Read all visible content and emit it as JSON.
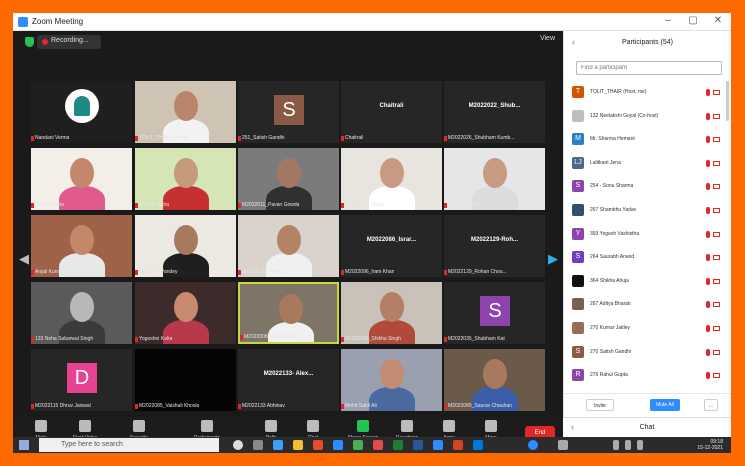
{
  "window": {
    "title": "Zoom Meeting"
  },
  "video": {
    "recording_label": "Recording...",
    "view_label": "View",
    "tiles": [
      {
        "name": "Nandani Verma",
        "kind": "logo",
        "bg": "#1f1f1f"
      },
      {
        "name": "TOLIT_THAIR (Guest)",
        "kind": "person",
        "bg": "#cfc3b3",
        "skin": "#b9856b",
        "cloth": "#f2f2f2"
      },
      {
        "name": "251_Satish Gandhi",
        "kind": "letter",
        "letter": "S",
        "color": "#8a5a44",
        "bg": "#262626"
      },
      {
        "name": "Chaitrali",
        "kind": "text",
        "caption": "Chaitrali",
        "bg": "#262626"
      },
      {
        "name": "M2022026_Shubham Kumb...",
        "kind": "text",
        "caption": "M2022022_Shub...",
        "bg": "#262626"
      },
      {
        "name": "Kajal Chawla",
        "kind": "person",
        "bg": "#f3efe8",
        "skin": "#c4876b",
        "cloth": "#e05a8c"
      },
      {
        "name": "Srishti - Saha",
        "kind": "person",
        "bg": "#d6e5b5",
        "skin": "#c79a7a",
        "cloth": "#c73030"
      },
      {
        "name": "M2022011_Pavan Gowda",
        "kind": "person",
        "bg": "#7b7b7b",
        "skin": "#a27860",
        "cloth": "#303030"
      },
      {
        "name": "M2022119_Disha",
        "kind": "person",
        "bg": "#e8e4de",
        "skin": "#c99a82",
        "cloth": "#ffffff"
      },
      {
        "name": "40_Shiv Kumari",
        "kind": "person",
        "bg": "#e6e6e6",
        "skin": "#c99a82",
        "cloth": "#dcdcdc"
      },
      {
        "name": "Anjali Kumari",
        "kind": "person",
        "bg": "#9e6248",
        "skin": "#c48869",
        "cloth": "#e8e8e8"
      },
      {
        "name": "Vaishnav Pandey",
        "kind": "person",
        "bg": "#ece8e2",
        "skin": "#a77a5e",
        "cloth": "#1f1f1f"
      },
      {
        "name": "M2022128_Kumar",
        "kind": "person",
        "bg": "#d9d3cc",
        "skin": "#b48265",
        "cloth": "#f0f0f0"
      },
      {
        "name": "M2022096_Iram Khan",
        "kind": "text",
        "caption": "M2022086_Israr...",
        "bg": "#262626"
      },
      {
        "name": "M2022129_Rohan Chou...",
        "kind": "text",
        "caption": "M2022129-Roh...",
        "bg": "#262626"
      },
      {
        "name": "133 Neha Sabarwal Singh",
        "kind": "person",
        "bg": "#5a5a5a",
        "skin": "#b8b8b8",
        "cloth": "#3a3a3a"
      },
      {
        "name": "Yogeshni Kalra",
        "kind": "person",
        "bg": "#3d2b2b",
        "skin": "#c78a70",
        "cloth": "#b83a4a"
      },
      {
        "name": "M2022008_Vikas Yadav",
        "kind": "person",
        "bg": "#7f7566",
        "skin": "#a9795e",
        "cloth": "#f0f0f0",
        "active": true
      },
      {
        "name": "M2022028_Shikha Singh",
        "kind": "person",
        "bg": "#c9c2b8",
        "skin": "#b57e66",
        "cloth": "#b04a3a"
      },
      {
        "name": "M2022035_Shubham Kat",
        "kind": "letter",
        "letter": "S",
        "color": "#8e44ad",
        "bg": "#262626"
      },
      {
        "name": "M2022115 Dhruv Jaiswal",
        "kind": "letter",
        "letter": "D",
        "color": "#e84393",
        "bg": "#262626"
      },
      {
        "name": "M2022085_Vaishali Khosla",
        "kind": "black",
        "bg": "#050505"
      },
      {
        "name": "M2022133 Abhinav",
        "kind": "text",
        "caption": "M2022133- Alex...",
        "bg": "#262626"
      },
      {
        "name": "Mohd Sahil Ali",
        "kind": "person",
        "bg": "#9aa0b0",
        "skin": "#c18c73",
        "cloth": "#4a6aa0"
      },
      {
        "name": "M2022089_Saurav Chauhan",
        "kind": "person",
        "bg": "#6b5a4a",
        "skin": "#a9795e",
        "cloth": "#3a5fa8"
      }
    ]
  },
  "toolbar": {
    "items": [
      {
        "label": "Mute"
      },
      {
        "label": "Start Video"
      },
      {
        "label": "Security"
      },
      {
        "label": "Participants"
      },
      {
        "label": "Polls"
      },
      {
        "label": "Chat"
      },
      {
        "label": "Share Screen"
      },
      {
        "label": "Reactions"
      },
      {
        "label": "Apps"
      },
      {
        "label": "More"
      }
    ],
    "leave_label": "End"
  },
  "participants": {
    "title": "Participants (54)",
    "search_placeholder": "Find a participant",
    "rows": [
      {
        "name": "TOLIT_THAIR (Host, me)",
        "avatar_color": "#d35400",
        "letter": "T"
      },
      {
        "name": "132 Neelakshi Goyal (Co-host)",
        "avatar_color": "#bdbdbd",
        "letter": ""
      },
      {
        "name": "Mr. Sharma Hemant",
        "avatar_color": "#2c7fc2",
        "letter": "M"
      },
      {
        "name": "Lalitkant Jena",
        "avatar_color": "#4a6a8a",
        "letter": "LJ"
      },
      {
        "name": "254 - Sonu Sharma",
        "avatar_color": "#8e44ad",
        "letter": "S"
      },
      {
        "name": "267 Shambhu Yadav",
        "avatar_color": "#2f4f6f",
        "letter": ""
      },
      {
        "name": "393 Yogesh Vashistha",
        "avatar_color": "#8e44ad",
        "letter": "Y"
      },
      {
        "name": "264 Saurabh Anand",
        "avatar_color": "#6c3fc6",
        "letter": "S"
      },
      {
        "name": "364 Shikha Ahuja",
        "avatar_color": "#111111",
        "letter": ""
      },
      {
        "name": "267 Aditya Bharati",
        "avatar_color": "#7a5f55",
        "letter": ""
      },
      {
        "name": "270 Kumar Jaitley",
        "avatar_color": "#9a6b55",
        "letter": ""
      },
      {
        "name": "270 Satish Gandhi",
        "avatar_color": "#8a5a44",
        "letter": "S"
      },
      {
        "name": "276 Rahul Gupta",
        "avatar_color": "#8e44ad",
        "letter": "R"
      }
    ],
    "invite_label": "Invite",
    "mute_all_label": "Mute All",
    "more_label": "..."
  },
  "chat": {
    "label": "Chat"
  },
  "taskbar": {
    "search_placeholder": "Type here to search",
    "time": "09:18",
    "date": "15-12-2021"
  }
}
